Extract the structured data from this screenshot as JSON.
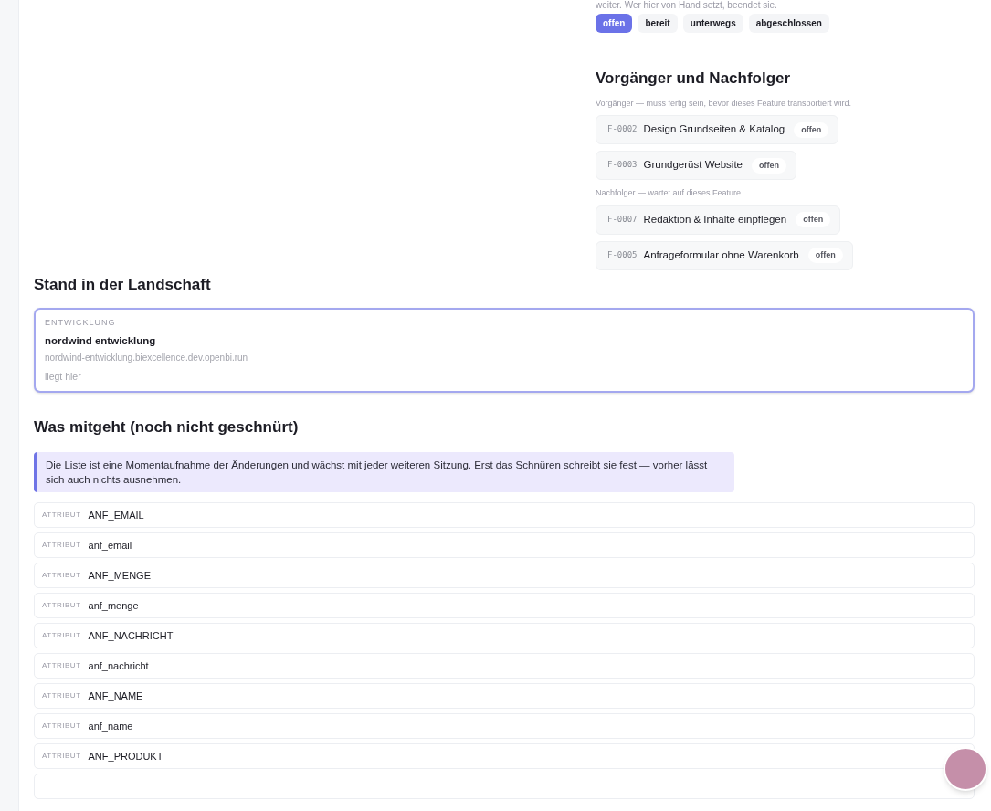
{
  "status_note": "weiter. Wer hier von Hand setzt, beendet sie.",
  "status_options": [
    {
      "label": "offen",
      "selected": true
    },
    {
      "label": "bereit",
      "selected": false
    },
    {
      "label": "unterwegs",
      "selected": false
    },
    {
      "label": "abgeschlossen",
      "selected": false
    }
  ],
  "dependencies": {
    "title": "Vorgänger und Nachfolger",
    "groups": [
      {
        "caption": "Vorgänger — muss fertig sein, bevor dieses Feature transportiert wird.",
        "items": [
          {
            "id": "F-0002",
            "name": "Design Grundseiten & Katalog",
            "status": "offen"
          },
          {
            "id": "F-0003",
            "name": "Grundgerüst Website",
            "status": "offen"
          }
        ]
      },
      {
        "caption": "Nachfolger — wartet auf dieses Feature.",
        "items": [
          {
            "id": "F-0007",
            "name": "Redaktion & Inhalte einpflegen",
            "status": "offen"
          },
          {
            "id": "F-0005",
            "name": "Anfrageformular ohne Warenkorb",
            "status": "offen"
          }
        ]
      }
    ]
  },
  "landscape": {
    "title": "Stand in der Landschaft",
    "environment": {
      "label": "ENTWICKLUNG",
      "name": "nordwind entwicklung",
      "host": "nordwind-entwicklung.biexcellence.dev.openbi.run",
      "note": "liegt hier",
      "current": true
    }
  },
  "changes": {
    "title": "Was mitgeht (noch nicht geschnürt)",
    "notice": "Die Liste ist eine Momentaufnahme der Änderungen und wächst mit jeder weiteren Sitzung. Erst das Schnüren schreibt sie fest — vorher lässt sich auch nichts ausnehmen.",
    "rows": [
      {
        "type": "ATTRIBUT",
        "name": "ANF_EMAIL"
      },
      {
        "type": "ATTRIBUT",
        "name": "anf_email"
      },
      {
        "type": "ATTRIBUT",
        "name": "ANF_MENGE"
      },
      {
        "type": "ATTRIBUT",
        "name": "anf_menge"
      },
      {
        "type": "ATTRIBUT",
        "name": "ANF_NACHRICHT"
      },
      {
        "type": "ATTRIBUT",
        "name": "anf_nachricht"
      },
      {
        "type": "ATTRIBUT",
        "name": "ANF_NAME"
      },
      {
        "type": "ATTRIBUT",
        "name": "anf_name"
      },
      {
        "type": "ATTRIBUT",
        "name": "ANF_PRODUKT"
      }
    ]
  }
}
